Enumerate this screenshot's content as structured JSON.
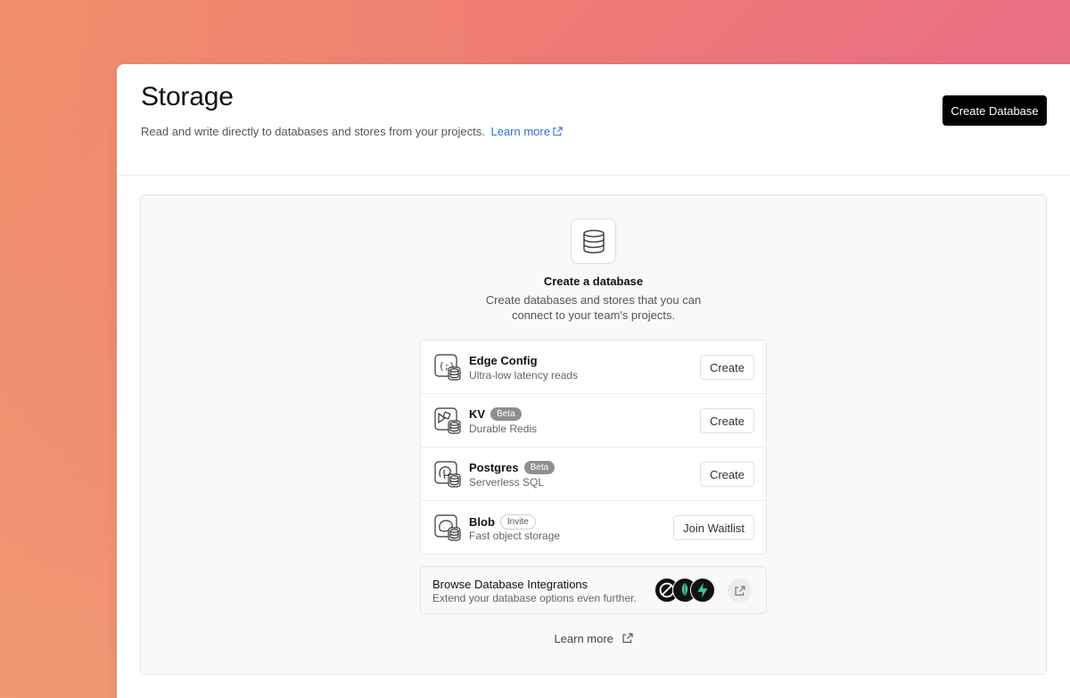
{
  "header": {
    "title": "Storage",
    "subtitle": "Read and write directly to databases and stores from your projects.",
    "learn_more": "Learn more",
    "create_button": "Create Database"
  },
  "empty_state": {
    "icon": "database-icon",
    "title": "Create a database",
    "description": "Create databases and stores that you can connect to your team's projects."
  },
  "stores": [
    {
      "name": "Edge Config",
      "badge": "",
      "description": "Ultra-low latency reads",
      "action": "Create",
      "icon": "edge-config-icon"
    },
    {
      "name": "KV",
      "badge": "Beta",
      "description": "Durable Redis",
      "action": "Create",
      "icon": "kv-icon"
    },
    {
      "name": "Postgres",
      "badge": "Beta",
      "description": "Serverless SQL",
      "action": "Create",
      "icon": "postgres-icon"
    },
    {
      "name": "Blob",
      "badge": "Invite",
      "description": "Fast object storage",
      "action": "Join Waitlist",
      "icon": "blob-icon"
    }
  ],
  "integrations": {
    "title": "Browse Database Integrations",
    "description": "Extend your database options even further.",
    "logos": [
      "integration-logo-1",
      "mongodb-logo",
      "supabase-logo"
    ],
    "accent_green": "#3ecf8e"
  },
  "footer": {
    "learn_more": "Learn more"
  },
  "colors": {
    "link": "#2f6fd8",
    "primary_button": "#000000",
    "beta_badge": "#8f8f8f"
  }
}
